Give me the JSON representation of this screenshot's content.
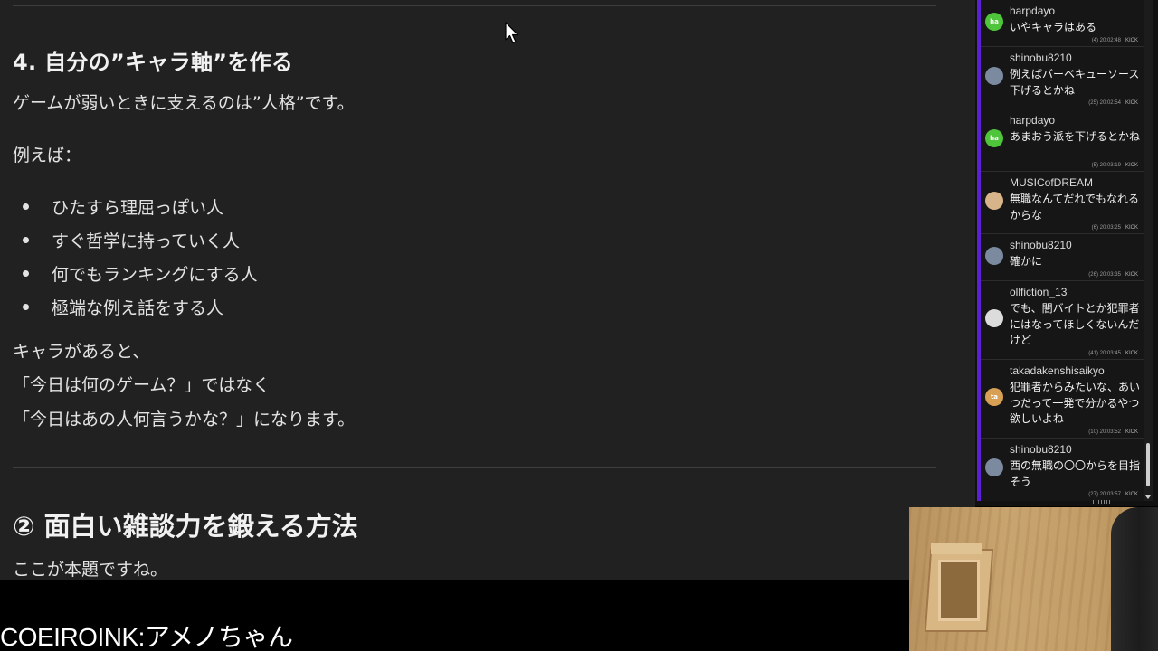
{
  "article": {
    "section4_heading": "4. 自分の”キャラ軸”を作る",
    "section4_intro": "ゲームが弱いときに支えるのは”人格”です。",
    "example_label": "例えば：",
    "bullets": [
      "ひたすら理屈っぽい人",
      "すぐ哲学に持っていく人",
      "何でもランキングにする人",
      "極端な例え話をする人"
    ],
    "conclusion_lines": [
      "キャラがあると、",
      "「今日は何のゲーム？」ではなく",
      "「今日はあの人何言うかな？」になります。"
    ],
    "section2_heading": "② 面白い雑談力を鍛える方法",
    "section2_intro": "ここが本題ですね。"
  },
  "chat": {
    "accent_color": "#5b1fd6",
    "messages": [
      {
        "user": "harpdayo",
        "text": "いやキャラはある",
        "count": "(4)",
        "time": "20:02:48",
        "action": "KICK",
        "avatar_label": "ha",
        "avatar_color": "#4ec53a"
      },
      {
        "user": "shinobu8210",
        "text": "例えばバーベキューソース下げるとかね",
        "count": "(25)",
        "time": "20:02:54",
        "action": "KICK",
        "avatar_label": "",
        "avatar_color": "#7c8aa0"
      },
      {
        "user": "harpdayo",
        "text": "あまおう派を下げるとかね",
        "count": "(5)",
        "time": "20:03:19",
        "action": "KICK",
        "avatar_label": "ha",
        "avatar_color": "#4ec53a"
      },
      {
        "user": "MUSICofDREAM",
        "text": "無職なんてだれでもなれるからな",
        "count": "(6)",
        "time": "20:03:25",
        "action": "KICK",
        "avatar_label": "",
        "avatar_color": "#d8b48a"
      },
      {
        "user": "shinobu8210",
        "text": "確かに",
        "count": "(26)",
        "time": "20:03:35",
        "action": "KICK",
        "avatar_label": "",
        "avatar_color": "#7c8aa0"
      },
      {
        "user": "ollfiction_13",
        "text": "でも、闇バイトとか犯罪者にはなってほしくないんだけど",
        "count": "(41)",
        "time": "20:03:45",
        "action": "KICK",
        "avatar_label": "",
        "avatar_color": "#dcdcdc"
      },
      {
        "user": "takadakenshisaikyo",
        "text": "犯罪者からみたいな、あいつだって一発で分かるやつ欲しいよね",
        "count": "(10)",
        "time": "20:03:52",
        "action": "KICK",
        "avatar_label": "ta",
        "avatar_color": "#d8a055"
      },
      {
        "user": "shinobu8210",
        "text": "西の無職の〇〇からを目指そう",
        "count": "(27)",
        "time": "20:03:57",
        "action": "KICK",
        "avatar_label": "",
        "avatar_color": "#7c8aa0"
      }
    ]
  },
  "caption": "COEIROINK:アメノちゃん",
  "icons": {
    "cursor": "mouse-pointer-icon",
    "avatar": "user-avatar-icon"
  }
}
